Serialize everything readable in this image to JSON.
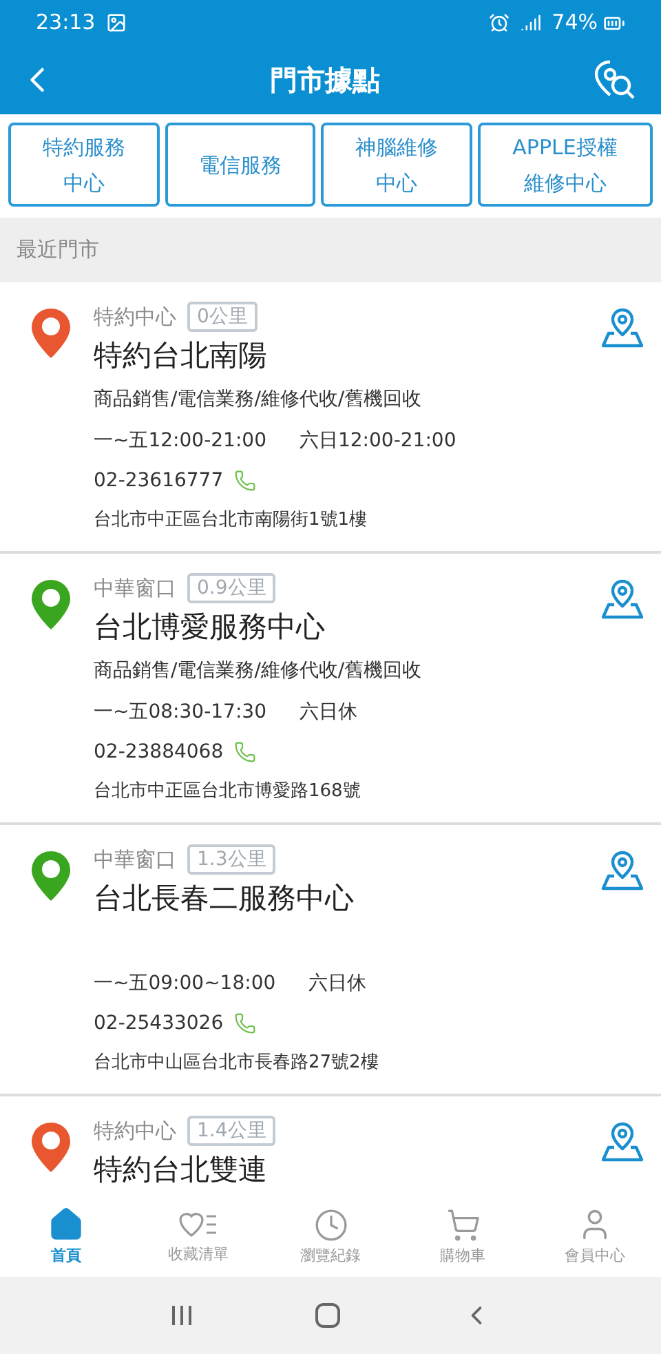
{
  "status_bar": {
    "time": "23:13",
    "battery": "74%"
  },
  "header": {
    "title": "門市據點"
  },
  "filters": [
    {
      "lines": [
        "特約服務",
        "中心"
      ]
    },
    {
      "lines": [
        "電信服務"
      ]
    },
    {
      "lines": [
        "神腦維修",
        "中心"
      ]
    },
    {
      "lines": [
        "APPLE授權",
        "維修中心"
      ]
    }
  ],
  "section_title": "最近門市",
  "stores": [
    {
      "category": "特約中心",
      "distance": "0公里",
      "color": "#e8572f",
      "name": "特約台北南陽",
      "services": "商品銷售/電信業務/維修代收/舊機回收",
      "weekday_hours": "一~五12:00-21:00",
      "weekend_hours": "六日12:00-21:00",
      "phone": "02-23616777",
      "address": "台北市中正區台北市南陽街1號1樓"
    },
    {
      "category": "中華窗口",
      "distance": "0.9公里",
      "color": "#3aa51f",
      "name": "台北博愛服務中心",
      "services": "商品銷售/電信業務/維修代收/舊機回收",
      "weekday_hours": "一~五08:30-17:30",
      "weekend_hours": "六日休",
      "phone": "02-23884068",
      "address": "台北市中正區台北市博愛路168號"
    },
    {
      "category": "中華窗口",
      "distance": "1.3公里",
      "color": "#3aa51f",
      "name": "台北長春二服務中心",
      "weekday_hours": "一~五09:00~18:00",
      "weekend_hours": "六日休",
      "phone": "02-25433026",
      "address": "台北市中山區台北市長春路27號2樓"
    },
    {
      "category": "特約中心",
      "distance": "1.4公里",
      "color": "#e8572f",
      "name": "特約台北雙連"
    }
  ],
  "nav": [
    {
      "kind": "home",
      "label": "首頁",
      "selected": true
    },
    {
      "kind": "favorites",
      "label": "收藏清單",
      "selected": false
    },
    {
      "kind": "history",
      "label": "瀏覽紀錄",
      "selected": false
    },
    {
      "kind": "cart",
      "label": "購物車",
      "selected": false
    },
    {
      "kind": "member",
      "label": "會員中心",
      "selected": false
    }
  ]
}
